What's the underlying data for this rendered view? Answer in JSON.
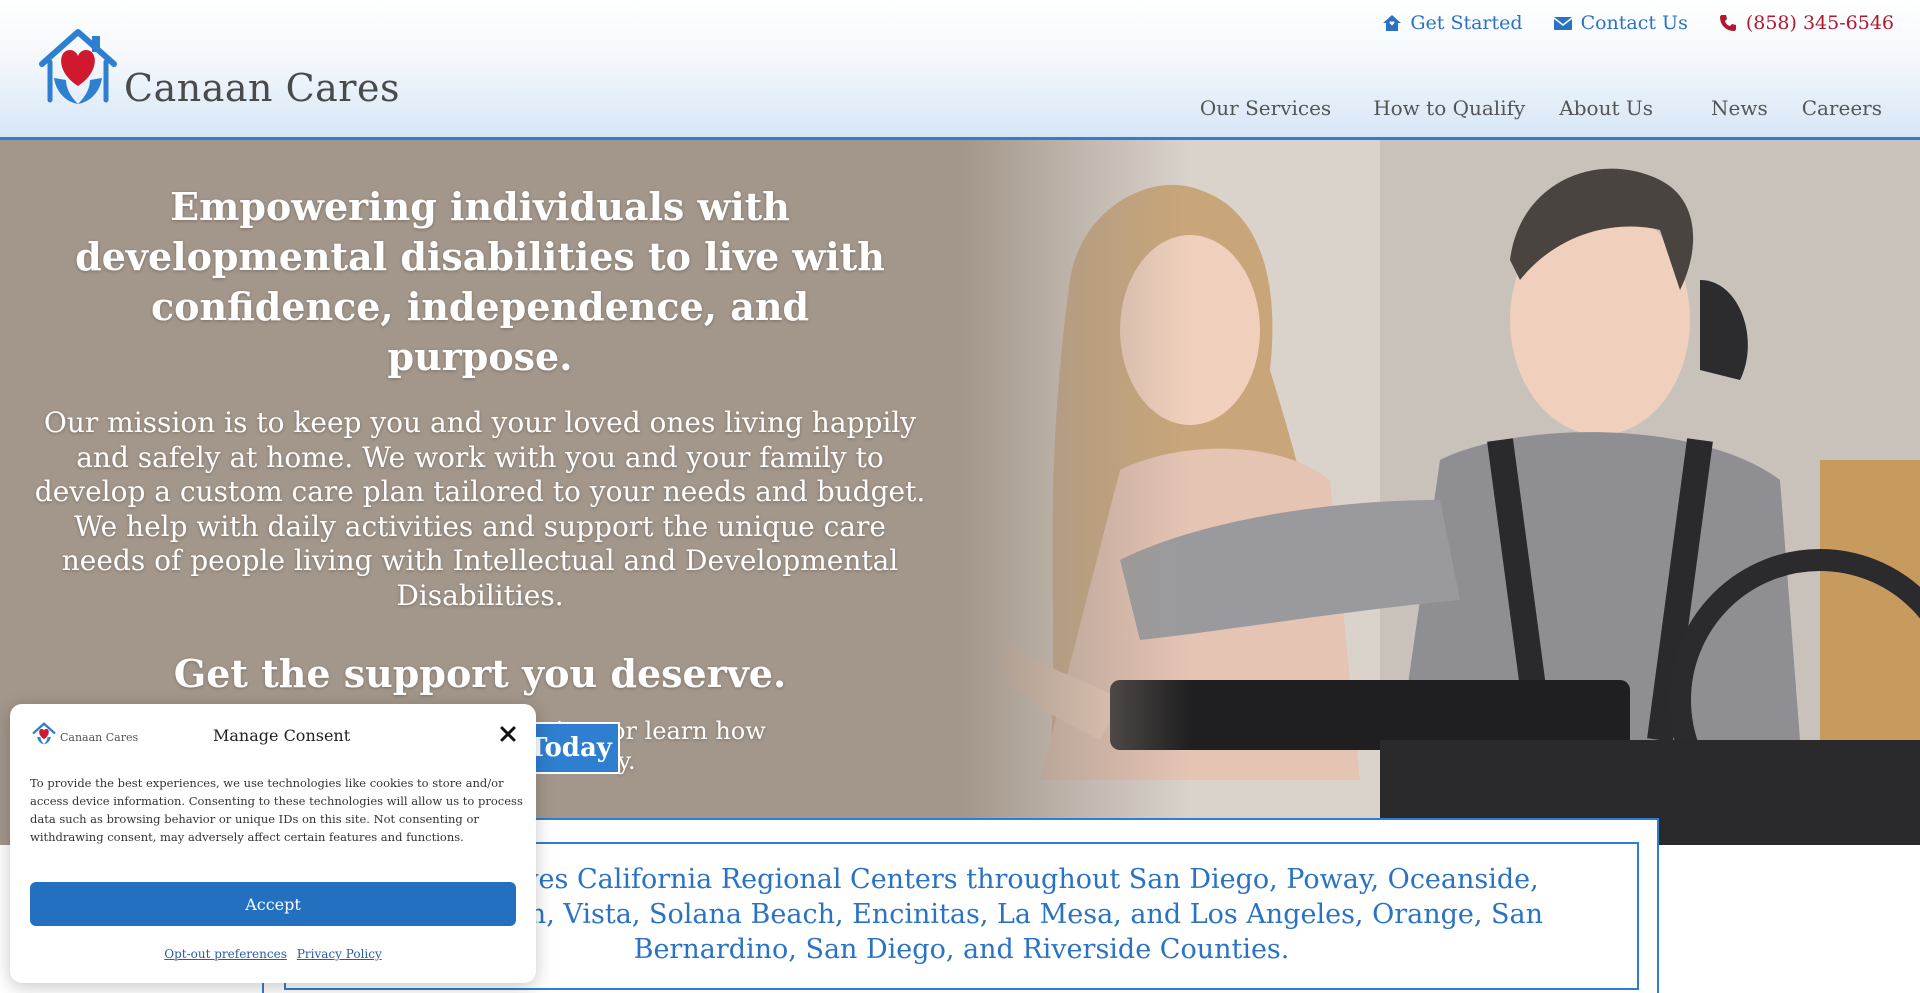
{
  "header": {
    "brand_name": "Canaan Cares",
    "logo_icon": "house-heart-hands-logo",
    "top_links": [
      {
        "label": "Get Started",
        "icon": "house-icon"
      },
      {
        "label": "Contact Us",
        "icon": "envelope-icon"
      },
      {
        "label": "(858) 345-6546",
        "icon": "phone-icon"
      }
    ],
    "nav": [
      "Our Services",
      "How to Qualify",
      "About Us",
      "News",
      "Careers"
    ]
  },
  "hero": {
    "title": "Empowering individuals with developmental disabilities to live with confidence, independence, and purpose.",
    "mission": "Our mission is to keep you and your loved ones living happily and safely at home. We work with you and your family to develop a custom care plan tailored to your needs and budget. We help with daily activities and support the unique care needs of people living with Intellectual and Developmental Disabilities.",
    "support_heading": "Get the support you deserve.",
    "contact_text": "Contact us today to start services or learn how we can assist your family.",
    "cta_label": "Today"
  },
  "service_area": {
    "text": "roudly serves California Regional Centers throughout San Diego, Poway, Oceanside, ad, El Cajon, Vista, Solana Beach, Encinitas, La Mesa, and Los Angeles, Orange, San Bernardino, San Diego, and Riverside Counties.",
    "line1": "roudly serves California Regional Centers throughout San Diego, Poway, Oceanside,",
    "line2": "ad, El Cajon, Vista, Solana Beach, Encinitas, La Mesa, and Los Angeles, Orange, San",
    "line3": "Bernardino, San Diego, and Riverside Counties."
  },
  "consent": {
    "brand_name": "Canaan Cares",
    "title": "Manage Consent",
    "body": "To provide the best experiences, we use technologies like cookies to store and/or access device information. Consenting to these technologies will allow us to process data such as browsing behavior or unique IDs on this site. Not consenting or withdrawing consent, may adversely affect certain features and functions.",
    "accept_label": "Accept",
    "optout_label": "Opt-out preferences",
    "privacy_label": "Privacy Policy"
  },
  "colors": {
    "accent_blue": "#2f7fd0",
    "link_blue": "#2a72c4",
    "phone_red": "#b0182f",
    "heart_red": "#d0192f"
  }
}
